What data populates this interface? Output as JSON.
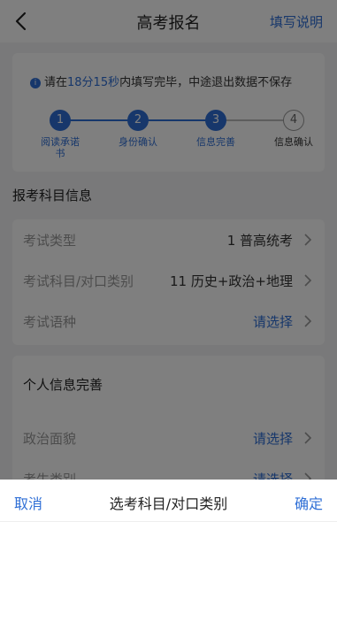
{
  "header": {
    "title": "高考报名",
    "help_label": "填写说明",
    "back_icon": "chevron-left-icon"
  },
  "notice": {
    "prefix": "请在",
    "time": "18分15秒",
    "suffix": "内填写完毕，中途退出数据不保存",
    "icon": "info-icon"
  },
  "steps": [
    {
      "num": "1",
      "label": "阅读承诺书",
      "state": "done"
    },
    {
      "num": "2",
      "label": "身份确认",
      "state": "done"
    },
    {
      "num": "3",
      "label": "信息完善",
      "state": "current"
    },
    {
      "num": "4",
      "label": "信息确认",
      "state": "pending"
    }
  ],
  "exam_section": {
    "title": "报考科目信息",
    "rows": [
      {
        "label": "考试类型",
        "value": "1 普高统考",
        "is_link": false
      },
      {
        "label": "考试科目/对口类别",
        "value": "11 历史+政治+地理",
        "is_link": false
      },
      {
        "label": "考试语种",
        "value": "请选择",
        "is_link": true
      }
    ]
  },
  "personal_section": {
    "title": "个人信息完善",
    "rows": [
      {
        "label": "政治面貌",
        "value": "请选择",
        "is_link": true
      },
      {
        "label": "考生类别",
        "value": "请选择",
        "is_link": true
      }
    ]
  },
  "picker": {
    "cancel_label": "取消",
    "title": "选考科目/对口类别",
    "confirm_label": "确定"
  },
  "colors": {
    "accent": "#2f6fd6",
    "overlay": "rgba(0,0,0,0.5)"
  }
}
